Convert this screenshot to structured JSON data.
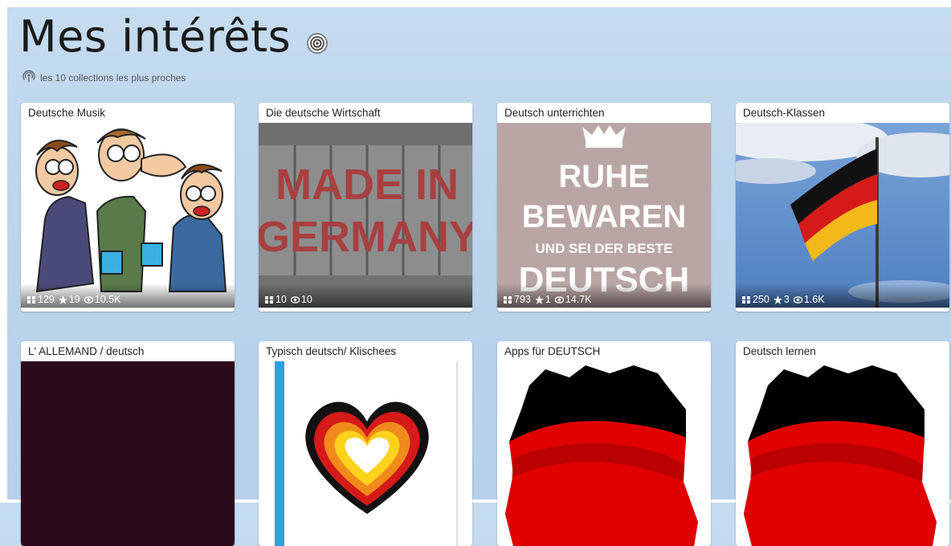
{
  "header": {
    "title": "Mes intérêts",
    "subtitle": "les 10 collections les plus proches"
  },
  "icons": {
    "title_icon": "target-icon",
    "subtitle_icon": "broadcast-icon",
    "stat_icons": [
      "grid-icon",
      "star-icon",
      "eye-icon"
    ]
  },
  "collections": [
    {
      "title": "Deutsche Musik",
      "scoops": "129",
      "stars": "19",
      "views": "10.5K",
      "image": "cartoon-people"
    },
    {
      "title": "Die deutsche Wirtschaft",
      "scoops": "10",
      "views": "10",
      "image": "made-in-germany"
    },
    {
      "title": "Deutsch unterrichten",
      "scoops": "793",
      "stars": "1",
      "views": "14.7K",
      "image": "ruhe-bewaren",
      "image_text": {
        "line1": "RUHE",
        "line2": "BEWAREN",
        "line3": "UND SEI DER BESTE",
        "line4": "DEUTSCH"
      }
    },
    {
      "title": "Deutsch-Klassen",
      "scoops": "250",
      "stars": "3",
      "views": "1.6K",
      "image": "german-flag"
    },
    {
      "title": "L' ALLEMAND / deutsch",
      "image": "dark-purple"
    },
    {
      "title": "Typisch deutsch/ Klischees",
      "image": "flag-heart"
    },
    {
      "title": "Apps für DEUTSCH",
      "image": "germany-map"
    },
    {
      "title": "Deutsch lernen",
      "image": "germany-map"
    }
  ],
  "made_in_text": {
    "line1": "MADE IN",
    "line2": "GERMANY"
  },
  "colors": {
    "accent_dark": "#2b0a1a",
    "flag_black": "#000000",
    "flag_red": "#dd0000",
    "flag_gold": "#ffce00"
  }
}
